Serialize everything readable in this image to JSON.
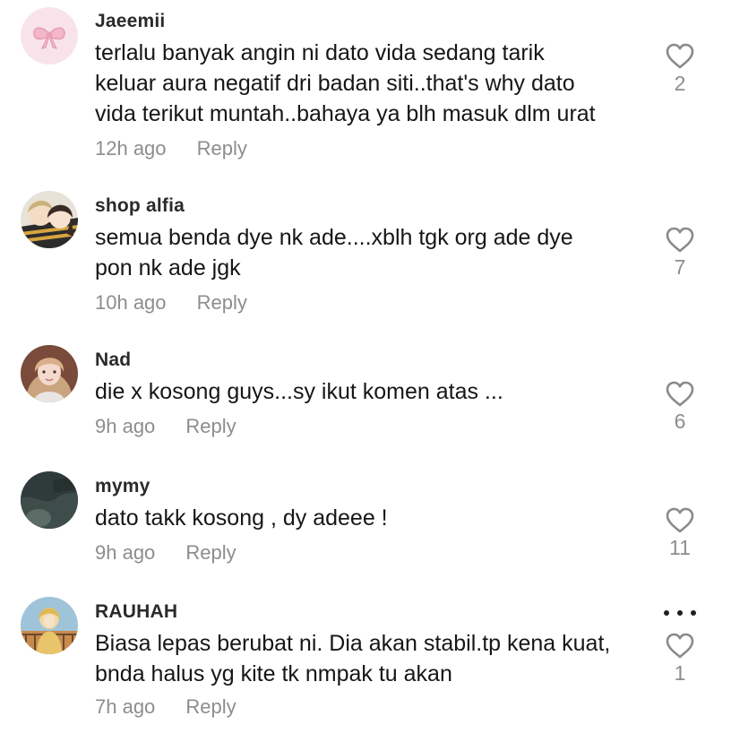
{
  "comments": [
    {
      "username": "Jaeemii",
      "lines": [
        "terlalu banyak angin ni dato vida sedang tarik",
        "keluar aura negatif dri badan siti..that's why dato",
        "vida terikut muntah..bahaya ya blh masuk dlm urat"
      ],
      "time": "12h ago",
      "reply_label": "Reply",
      "likes": "2",
      "avatar_icon": "pink-bow-avatar"
    },
    {
      "username": "shop alfia",
      "lines": [
        "semua benda dye nk ade....xblh tgk org ade dye",
        "pon nk ade jgk"
      ],
      "time": "10h ago",
      "reply_label": "Reply",
      "likes": "7",
      "avatar_icon": "anime-couple-avatar"
    },
    {
      "username": "Nad",
      "lines": [
        "die x kosong guys...sy ikut komen atas ..."
      ],
      "time": "9h ago",
      "reply_label": "Reply",
      "likes": "6",
      "avatar_icon": "girl-photo-avatar"
    },
    {
      "username": "mymy",
      "lines": [
        "dato takk kosong , dy adeee !"
      ],
      "time": "9h ago",
      "reply_label": "Reply",
      "likes": "11",
      "avatar_icon": "dark-photo-avatar"
    },
    {
      "username": "RAUHAH",
      "lines": [
        "Biasa lepas berubat ni. Dia akan stabil.tp kena kuat,",
        "bnda halus yg kite tk nmpak tu akan"
      ],
      "time": "7h ago",
      "reply_label": "Reply",
      "likes": "1",
      "avatar_icon": "hijab-woman-avatar"
    }
  ],
  "more_icon": "more-dots-icon",
  "like_icon": "heart-outline-icon",
  "colors": {
    "text": "#161616",
    "meta": "#8d8d8d",
    "username": "#2a2a2a"
  }
}
